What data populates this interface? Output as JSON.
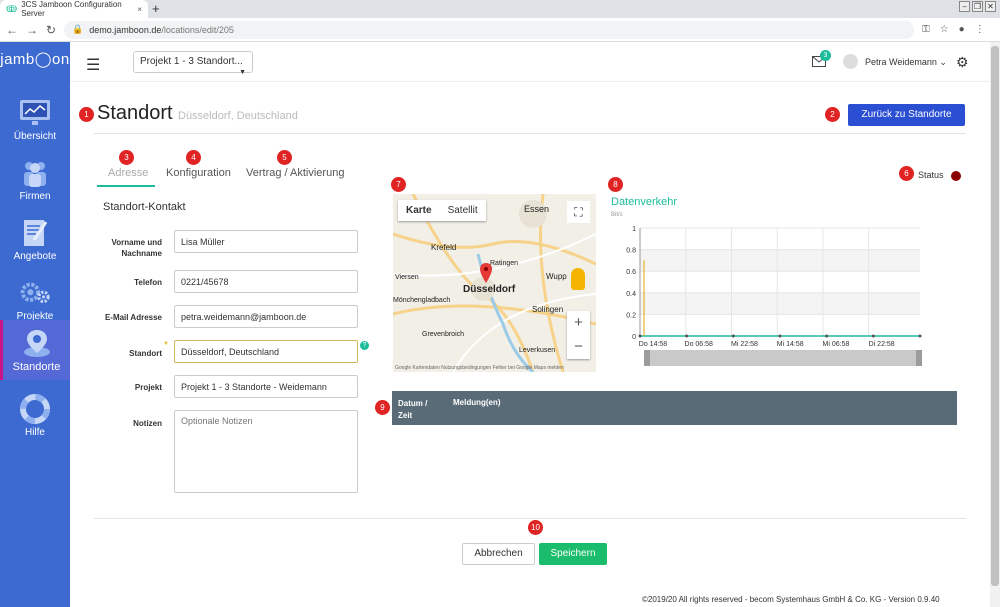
{
  "browser": {
    "tab_title": "3CS Jamboon Configuration Server",
    "tab_close": "×",
    "new_tab": "+",
    "url_host": "demo.jamboon.de",
    "url_path": "/locations/edit/205"
  },
  "sidebar": {
    "logo": "jamb◯on",
    "items": [
      {
        "label": "Übersicht"
      },
      {
        "label": "Firmen"
      },
      {
        "label": "Angebote"
      },
      {
        "label": "Projekte"
      },
      {
        "label": "Standorte"
      },
      {
        "label": "Hilfe"
      }
    ]
  },
  "header": {
    "project_select": "Projekt 1 - 3 Standort...",
    "mail_count": "3",
    "user_name": "Petra Weidemann"
  },
  "page": {
    "title": "Standort",
    "subtitle": "Düsseldorf, Deutschland",
    "back_button": "Zurück zu Standorte",
    "status_label": "Status",
    "status_color": "#8b0000"
  },
  "tabs": [
    {
      "label": "Adresse"
    },
    {
      "label": "Konfiguration"
    },
    {
      "label": "Vertrag / Aktivierung"
    }
  ],
  "badges": [
    "1",
    "2",
    "3",
    "4",
    "5",
    "6",
    "7",
    "8",
    "9",
    "10"
  ],
  "form": {
    "title": "Standort-Kontakt",
    "name_label": "Vorname und Nachname",
    "name_value": "Lisa Müller",
    "phone_label": "Telefon",
    "phone_value": "0221/45678",
    "email_label": "E-Mail Adresse",
    "email_value": "petra.weidemann@jamboon.de",
    "location_label": "Standort",
    "location_value": "Düsseldorf, Deutschland",
    "required_mark": "*",
    "help_mark": "?",
    "project_label": "Projekt",
    "project_value": "Projekt 1 - 3 Standorte - Weidemann",
    "notes_label": "Notizen",
    "notes_placeholder": "Optionale Notizen"
  },
  "map": {
    "tab_map": "Karte",
    "tab_satellite": "Satellit",
    "zoom_in": "+",
    "zoom_out": "−",
    "cities": [
      "Essen",
      "Krefeld",
      "Ratingen",
      "Wupp",
      "Viersen",
      "Düsseldorf",
      "Solingen",
      "Mönchengladbach",
      "Grevenbroich",
      "Leverkusen"
    ],
    "footer": "Google   Kartendaten   Nutzungsbedingungen   Fehler bei Google Maps melden"
  },
  "chart_data": {
    "type": "line",
    "title": "Datenverkehr",
    "ylabel": "Bit/s",
    "ylim": [
      0,
      1
    ],
    "yticks": [
      "0",
      "0.2",
      "0.4",
      "0.6",
      "0.8",
      "1"
    ],
    "categories": [
      "Do 14:58",
      "Do 06:58",
      "Mi 22:58",
      "Mi 14:58",
      "Mi 06:58",
      "Di 22:58"
    ],
    "series": [
      {
        "values": [
          0,
          0,
          0,
          0,
          0,
          0,
          0
        ]
      }
    ],
    "accent": "#1bbc9b"
  },
  "table": {
    "col_date": "Datum / Zeit",
    "col_msg": "Meldung(en)"
  },
  "actions": {
    "cancel": "Abbrechen",
    "save": "Speichern"
  },
  "footer": "©2019/20 All rights reserved - becom Systemhaus GmbH & Co. KG - Version 0.9.40"
}
